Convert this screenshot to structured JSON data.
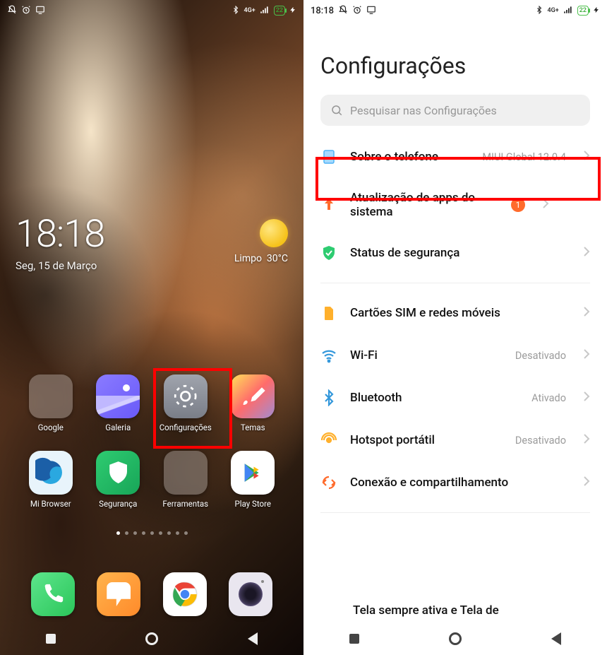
{
  "status": {
    "time": "18:18",
    "network_label": "4G+",
    "battery_pct": "22"
  },
  "home": {
    "clock": "18:18",
    "date": "Seg, 15 de Março",
    "weather_cond": "Limpo",
    "weather_temp": "30°C",
    "apps_row1": [
      {
        "label": "Google"
      },
      {
        "label": "Galeria"
      },
      {
        "label": "Configurações"
      },
      {
        "label": "Temas"
      }
    ],
    "apps_row2": [
      {
        "label": "Mi Browser"
      },
      {
        "label": "Segurança"
      },
      {
        "label": "Ferramentas"
      },
      {
        "label": "Play Store"
      }
    ]
  },
  "settings": {
    "title": "Configurações",
    "search_placeholder": "Pesquisar nas Configurações",
    "rows": {
      "about": {
        "label": "Sobre o telefone",
        "value": "MIUI Global 12.0.4"
      },
      "sysapps": {
        "label": "Atualização de apps do sistema",
        "badge": "1"
      },
      "security_status": {
        "label": "Status de segurança"
      },
      "sim": {
        "label": "Cartões SIM e redes móveis"
      },
      "wifi": {
        "label": "Wi-Fi",
        "value": "Desativado"
      },
      "bt": {
        "label": "Bluetooth",
        "value": "Ativado"
      },
      "hotspot": {
        "label": "Hotspot portátil",
        "value": "Desativado"
      },
      "conn": {
        "label": "Conexão e compartilhamento"
      },
      "aod": {
        "label": "Tela sempre ativa e Tela de"
      }
    }
  }
}
